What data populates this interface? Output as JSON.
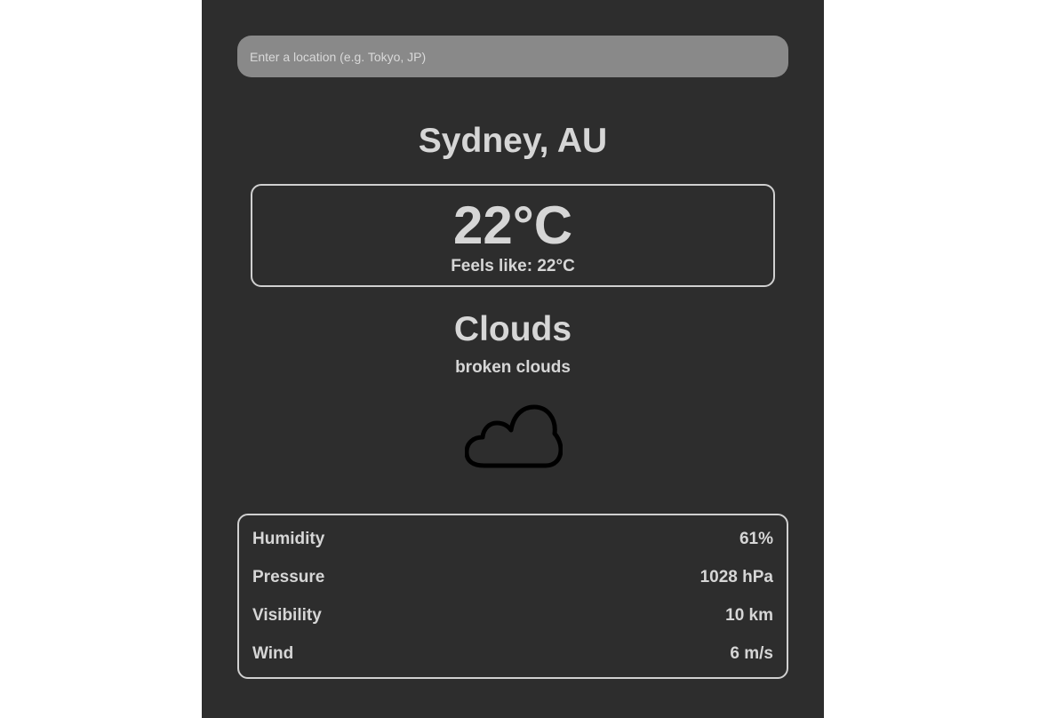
{
  "search": {
    "placeholder": "Enter a location (e.g. Tokyo, JP)"
  },
  "location": {
    "name": "Sydney, AU"
  },
  "temperature": {
    "current": "22°C",
    "feels_like": "Feels like: 22°C"
  },
  "weather": {
    "main": "Clouds",
    "description": "broken clouds",
    "icon": "cloud-icon"
  },
  "stats": [
    {
      "label": "Humidity",
      "value": "61%"
    },
    {
      "label": "Pressure",
      "value": "1028 hPa"
    },
    {
      "label": "Visibility",
      "value": "10 km"
    },
    {
      "label": "Wind",
      "value": "6 m/s"
    }
  ],
  "colors": {
    "panel_background": "#2d2d2d",
    "search_background": "#898989",
    "text": "#d6d6d6",
    "border": "#d0d0d0"
  }
}
